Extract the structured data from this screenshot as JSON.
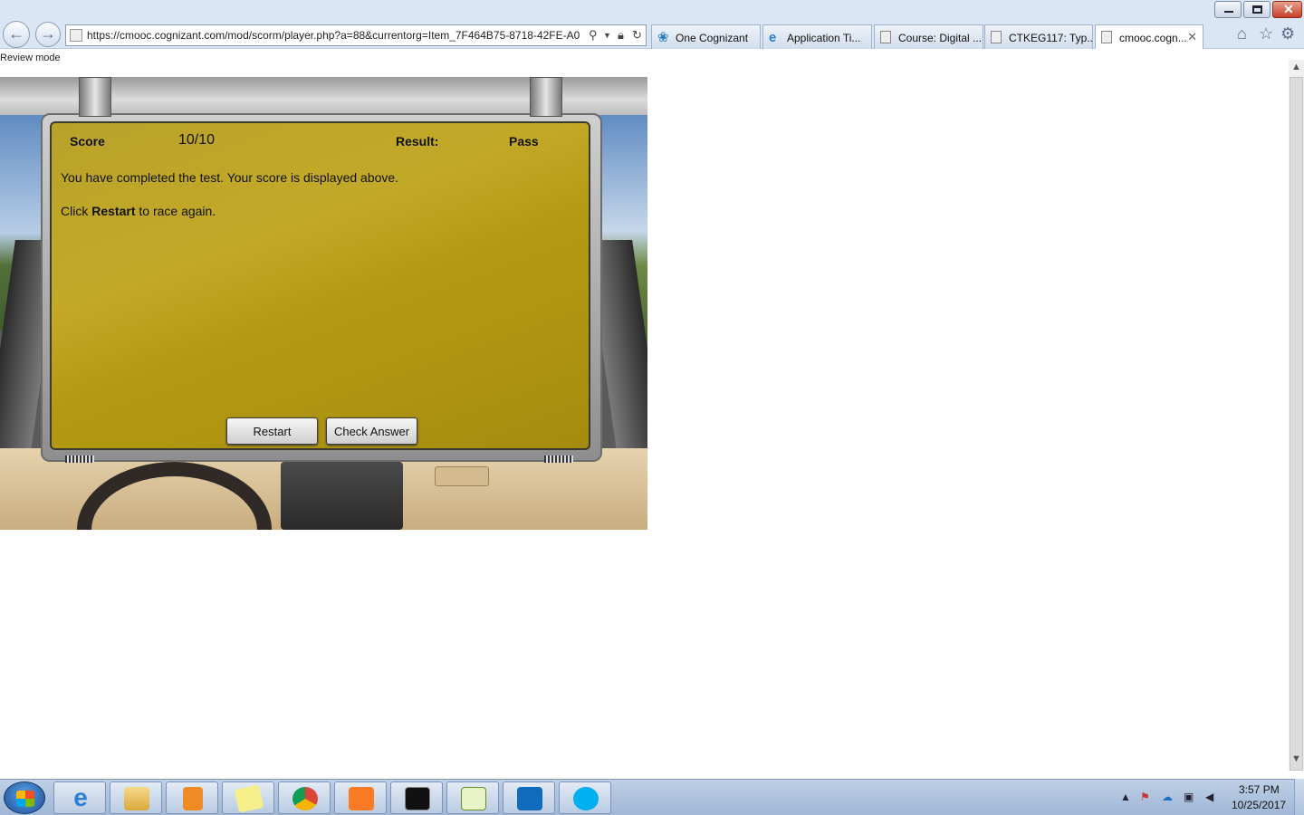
{
  "browser": {
    "url": "https://cmooc.cognizant.com/mod/scorm/player.php?a=88&currentorg=Item_7F464B75-8718-42FE-A0",
    "tabs": [
      {
        "label": "One Cognizant",
        "icon": "cognizant-icon"
      },
      {
        "label": "Application Ti...",
        "icon": "ie-icon"
      },
      {
        "label": "Course: Digital ...",
        "icon": "page-icon"
      },
      {
        "label": "CTKEG117: Typ...",
        "icon": "page-icon"
      },
      {
        "label": "cmooc.cogn...",
        "icon": "page-icon",
        "active": true
      }
    ],
    "tab_close": "✕"
  },
  "page": {
    "review_mode": "Review mode"
  },
  "quiz": {
    "score_label": "Score",
    "score_value": "10/10",
    "result_label": "Result:",
    "result_value": "Pass",
    "completed_message": "You have completed the test. Your score is displayed above.",
    "restart_prefix": "Click ",
    "restart_bold": "Restart",
    "restart_suffix": " to race again.",
    "restart_button": "Restart",
    "check_answer_button": "Check Answer",
    "panel_color": "#b8a22a"
  },
  "taskbar": {
    "apps": [
      "internet-explorer",
      "file-explorer",
      "media-player",
      "sticky-notes",
      "chrome",
      "xampp",
      "command-prompt",
      "notepad-plus-plus",
      "outlook",
      "skype"
    ],
    "clock_time": "3:57 PM",
    "clock_date": "10/25/2017"
  }
}
